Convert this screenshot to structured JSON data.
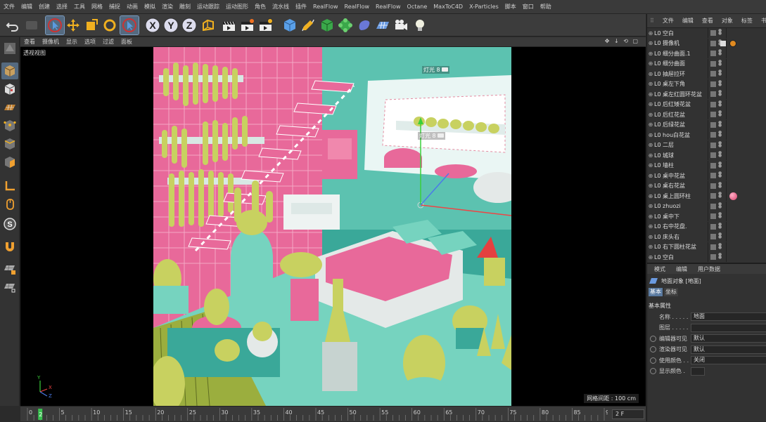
{
  "menubar": {
    "items": [
      "文件",
      "编辑",
      "创建",
      "选择",
      "工具",
      "网格",
      "捕捉",
      "动画",
      "模拟",
      "渲染",
      "雕刻",
      "运动跟踪",
      "运动图形",
      "角色",
      "流水线",
      "插件",
      "RealFlow",
      "RealFlow",
      "RealFlow",
      "Octane",
      "MaxToC4D",
      "X-Particles",
      "脚本",
      "窗口",
      "帮助"
    ]
  },
  "toolbar": {
    "icons": [
      "undo-icon",
      "redo-icon",
      "live-select-icon",
      "move-icon",
      "scale-icon",
      "rotate-icon",
      "recent-tool-icon",
      "x-axis-lock-icon",
      "y-axis-lock-icon",
      "z-axis-lock-icon",
      "coordinate-system-icon",
      "render-view-icon",
      "render-picture-viewer-icon",
      "render-settings-icon",
      "cube-object-icon",
      "pen-spline-icon",
      "subdivision-nurbs-icon",
      "array-cloner-icon",
      "deformer-icon",
      "floor-plane-icon",
      "camera-icon",
      "light-icon"
    ]
  },
  "viewport": {
    "menu": [
      "查看",
      "摄像机",
      "显示",
      "选项",
      "过滤",
      "面板"
    ],
    "title": "透视视图",
    "grid_label": "网格间距 : 100 cm",
    "light_tags": [
      "灯光 8",
      "灯光 8"
    ],
    "axis": {
      "y": "Y",
      "x": "X",
      "z": "Z"
    },
    "scene_colors": {
      "pink": "#e8699a",
      "mint": "#76d3bf",
      "yellow": "#c8d160",
      "teal": "#3aa899",
      "olive": "#9bae3e"
    }
  },
  "timeline": {
    "ticks": [
      "0",
      "5",
      "10",
      "15",
      "20",
      "25",
      "30",
      "35",
      "40",
      "45",
      "50",
      "55",
      "60",
      "65",
      "70",
      "75",
      "80",
      "85",
      "90"
    ],
    "current_frame": "2",
    "frame_field": "2 F"
  },
  "object_manager": {
    "menu": [
      "文件",
      "编辑",
      "查看",
      "对象",
      "标签",
      "书签"
    ],
    "objects": [
      {
        "name": "空白",
        "layer": "L0"
      },
      {
        "name": "摄像机",
        "layer": "L0"
      },
      {
        "name": "细分曲面.1",
        "layer": "L0"
      },
      {
        "name": "细分曲面",
        "layer": "L0"
      },
      {
        "name": "抽屉拉环",
        "layer": "L0"
      },
      {
        "name": "桌左下角",
        "layer": "L0"
      },
      {
        "name": "桌左红圆环花盆",
        "layer": "L0"
      },
      {
        "name": "后红矮花盆",
        "layer": "L0"
      },
      {
        "name": "后红花盆",
        "layer": "L0"
      },
      {
        "name": "后绿花盆",
        "layer": "L0"
      },
      {
        "name": "hou白花盆",
        "layer": "L0"
      },
      {
        "name": "二层",
        "layer": "L0"
      },
      {
        "name": "城球",
        "layer": "L0"
      },
      {
        "name": "墙柱",
        "layer": "L0"
      },
      {
        "name": "桌中花盆",
        "layer": "L0"
      },
      {
        "name": "桌右花盆",
        "layer": "L0"
      },
      {
        "name": "桌上圆环柱",
        "layer": "L0"
      },
      {
        "name": "zhuozi",
        "layer": "L0"
      },
      {
        "name": "桌中下",
        "layer": "L0"
      },
      {
        "name": "右中花盘.",
        "layer": "L0"
      },
      {
        "name": "床头右",
        "layer": "L0"
      },
      {
        "name": "右下圆柱花盆",
        "layer": "L0"
      },
      {
        "name": "空白",
        "layer": "L0"
      }
    ]
  },
  "attribute_manager": {
    "menu": [
      "模式",
      "编辑",
      "用户数据"
    ],
    "object_title": "地面对象 [地面]",
    "tabs": [
      "基本",
      "坐标"
    ],
    "section": "基本属性",
    "fields": [
      {
        "label": "名称 . . . . .",
        "value": "地面",
        "radio": false
      },
      {
        "label": "图层 . . . . .",
        "value": "",
        "radio": false
      },
      {
        "label": "编辑器可见",
        "value": "默认",
        "radio": true
      },
      {
        "label": "渲染器可见",
        "value": "默认",
        "radio": true
      },
      {
        "label": "使用颜色 . .",
        "value": "关闭",
        "radio": true
      },
      {
        "label": "显示颜色 .",
        "value": "",
        "radio": true
      }
    ]
  }
}
